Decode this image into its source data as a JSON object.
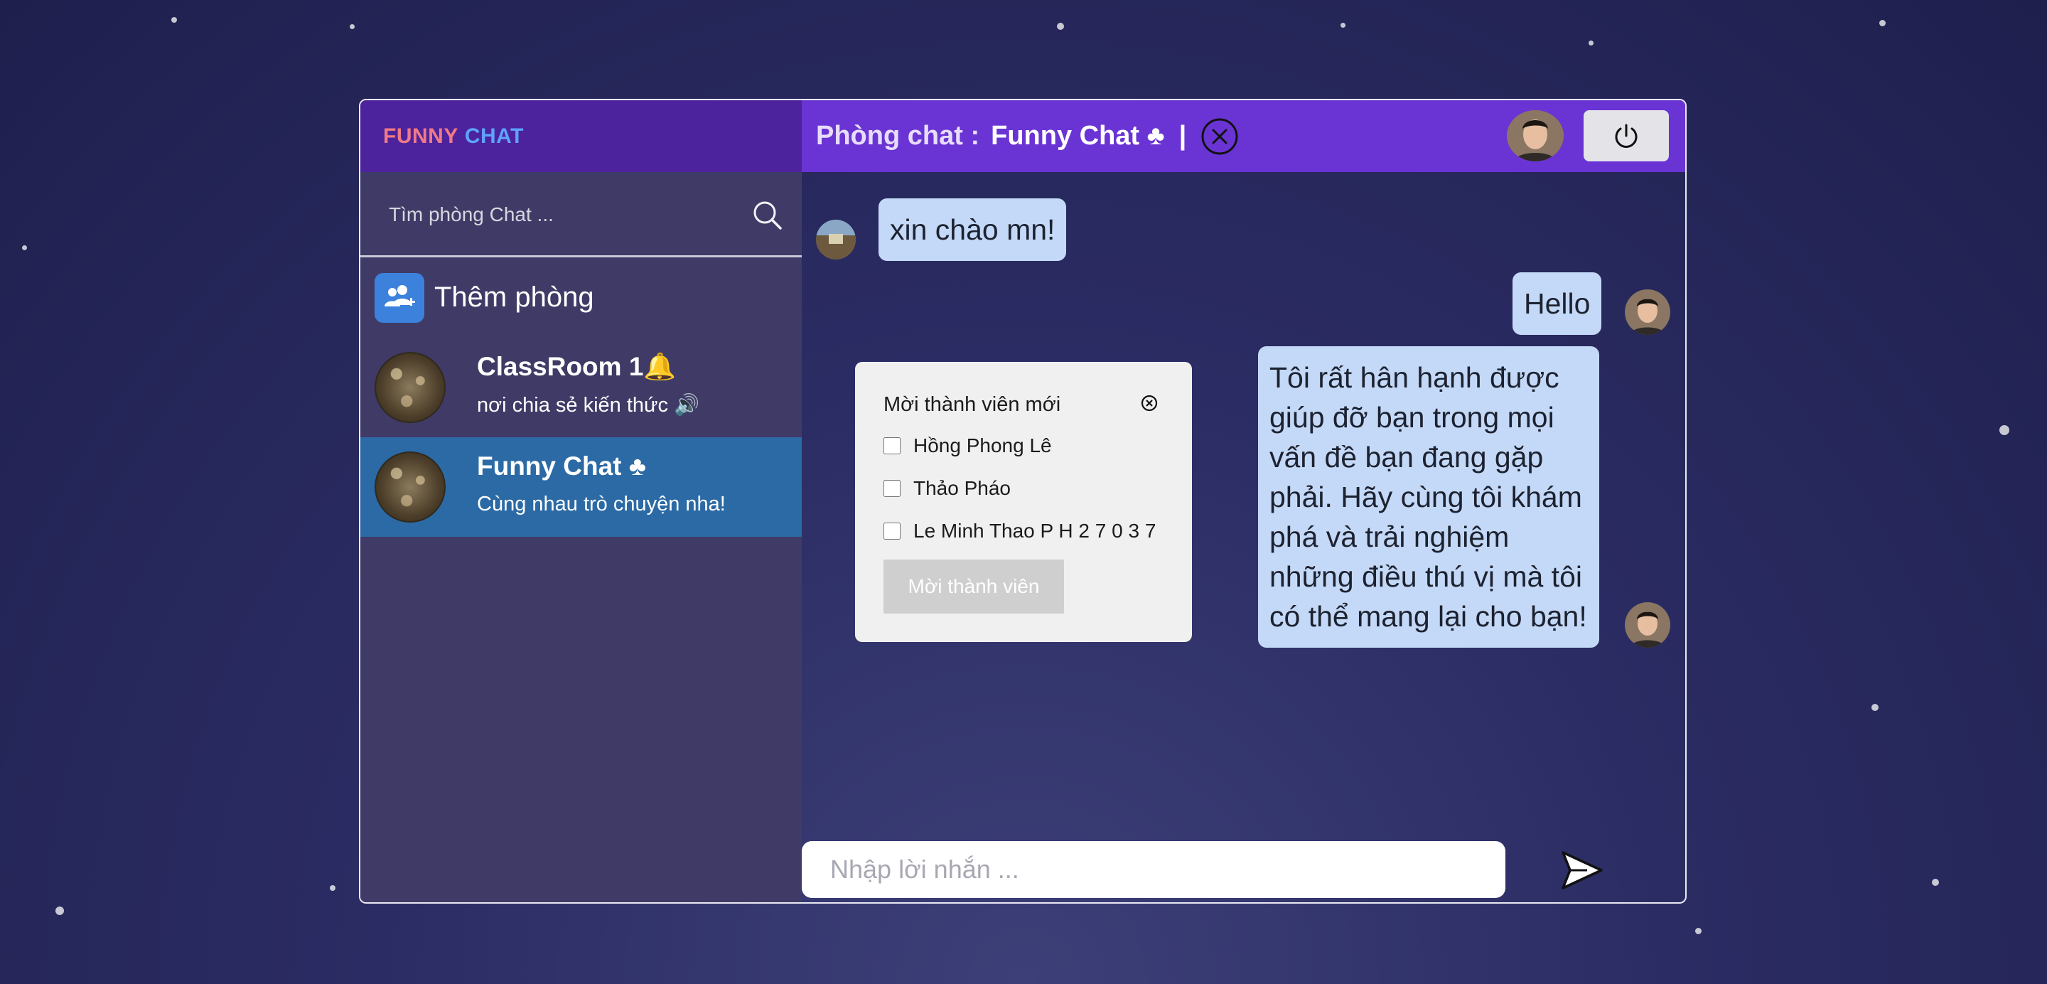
{
  "brand": {
    "part1": "FUNNY",
    "part2": "CHAT"
  },
  "search": {
    "placeholder": "Tìm phòng Chat ..."
  },
  "sidebar": {
    "add_room_label": "Thêm phòng",
    "rooms": [
      {
        "name": "ClassRoom 1🔔",
        "description": "nơi chia sẻ kiến thức 🔊"
      },
      {
        "name": "Funny Chat ♣",
        "description": "Cùng nhau trò chuyện nha!"
      }
    ]
  },
  "header": {
    "title": "Phòng chat :",
    "room_name": "Funny Chat ♣",
    "separator": "|"
  },
  "messages": [
    {
      "text": "xin chào mn!",
      "side": "left"
    },
    {
      "text": "Hello",
      "side": "right"
    },
    {
      "text": "Tôi rất hân hạnh được giúp đỡ bạn trong mọi vấn đề bạn đang gặp phải. Hãy cùng tôi khám phá và trải nghiệm những điều thú vị mà tôi có thể mang lại cho bạn!",
      "side": "right"
    }
  ],
  "invite": {
    "title": "Mời thành viên mới",
    "members": [
      "Hồng Phong Lê",
      "Thảo Pháo",
      "Le Minh Thao P H 2 7 0 3 7"
    ],
    "button_label": "Mời thành viên"
  },
  "composer": {
    "placeholder": "Nhập lời nhắn ..."
  },
  "icons": {
    "search": "search-icon",
    "add_room": "add-group-icon",
    "close": "close-circle-icon",
    "power": "power-icon",
    "send": "send-icon"
  },
  "colors": {
    "header_purple": "#6a34d4",
    "brand_bar": "#4c239c",
    "sidebar_bg": "#3f3b66",
    "active_room": "#2c6aa5",
    "bubble": "#c4d9f7",
    "brand_red": "#f07a86",
    "brand_blue": "#5fa2ff"
  }
}
